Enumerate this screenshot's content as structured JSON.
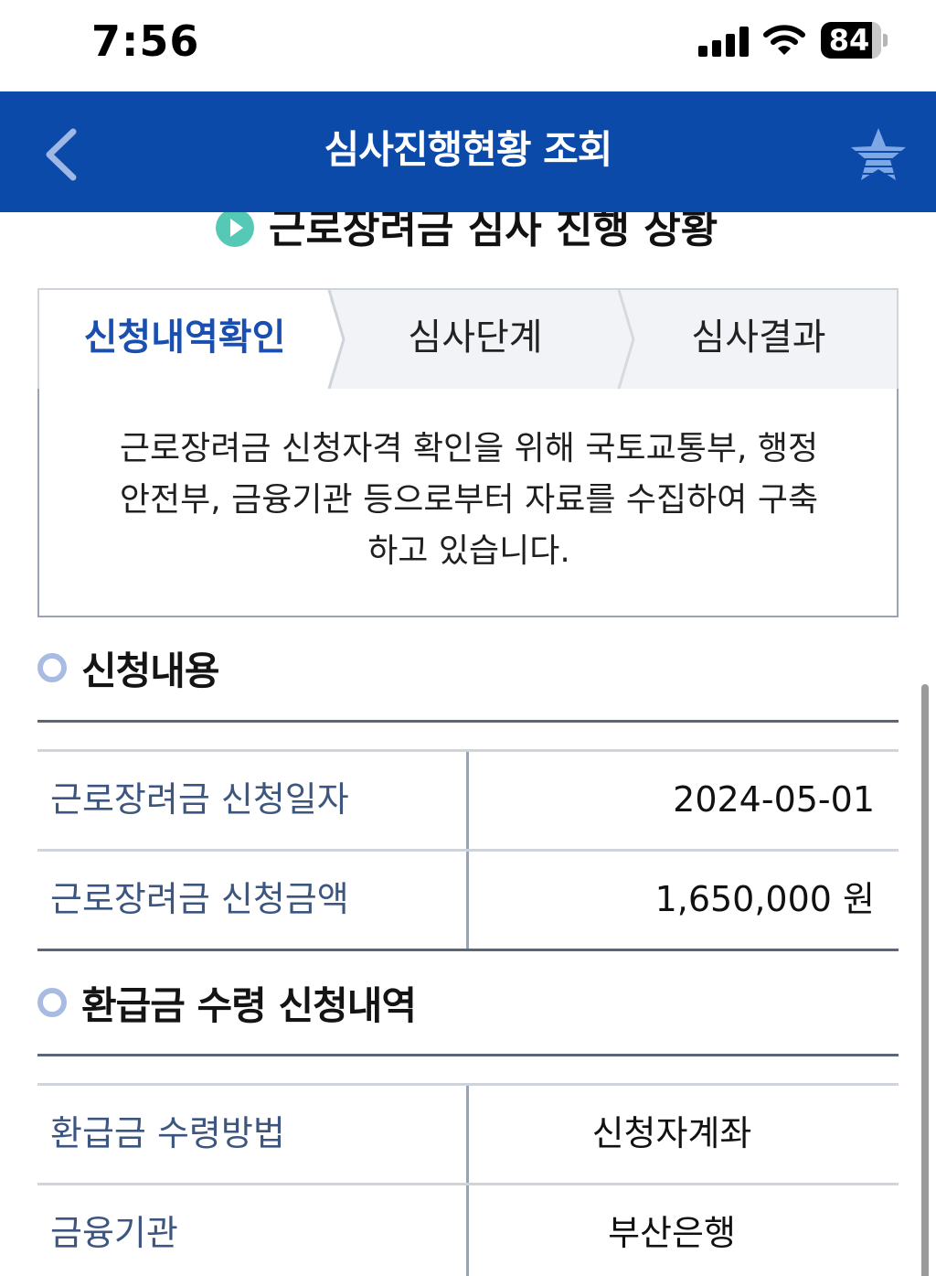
{
  "status_bar": {
    "time": "7:56",
    "battery": "84"
  },
  "header": {
    "title": "심사진행현황 조회"
  },
  "hidden_heading": "근로장려금 심사 진행 상황",
  "steps": [
    {
      "label": "신청내역확인",
      "active": true
    },
    {
      "label": "심사단계",
      "active": false
    },
    {
      "label": "심사결과",
      "active": false
    }
  ],
  "info": {
    "lines": [
      "근로장려금 신청자격 확인을 위해 국토교통부, 행정",
      "안전부, 금융기관 등으로부터 자료를 수집하여 구축",
      "하고 있습니다."
    ]
  },
  "application": {
    "title": "신청내용",
    "rows": [
      {
        "label": "근로장려금 신청일자",
        "value": "2024-05-01"
      },
      {
        "label": "근로장려금 신청금액",
        "value": "1,650,000 원"
      }
    ]
  },
  "refund": {
    "title": "환급금 수령 신청내역",
    "rows": [
      {
        "label": "환급금 수령방법",
        "value": "신청자계좌"
      },
      {
        "label": "금융기관",
        "value": "부산은행"
      }
    ]
  },
  "colors": {
    "header_bg": "#0c4aa9",
    "active_step": "#1a4fb0",
    "label_text": "#3d5680",
    "play_icon": "#55c8b6",
    "section_dot": "#a9bbe2"
  }
}
